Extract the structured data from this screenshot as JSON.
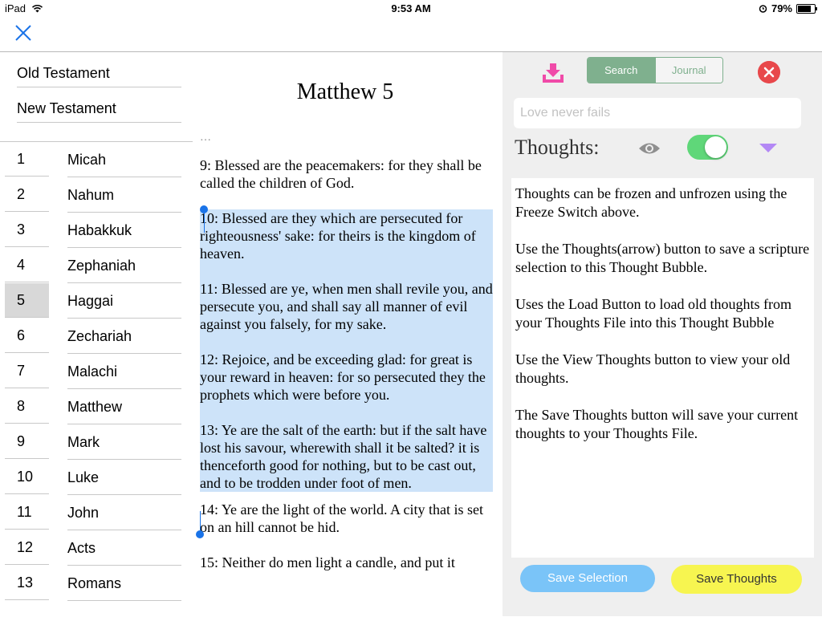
{
  "status_bar": {
    "device": "iPad",
    "time": "9:53 AM",
    "battery": "79%",
    "battery_level": 0.79
  },
  "testaments": [
    {
      "label": "Old Testament"
    },
    {
      "label": "New Testament"
    }
  ],
  "books": [
    {
      "num": "1",
      "name": "Micah"
    },
    {
      "num": "2",
      "name": "Nahum"
    },
    {
      "num": "3",
      "name": "Habakkuk"
    },
    {
      "num": "4",
      "name": "Zephaniah"
    },
    {
      "num": "5",
      "name": "Haggai",
      "selected": true
    },
    {
      "num": "6",
      "name": "Zechariah"
    },
    {
      "num": "7",
      "name": "Malachi"
    },
    {
      "num": "8",
      "name": "Matthew"
    },
    {
      "num": "9",
      "name": "Mark"
    },
    {
      "num": "10",
      "name": "Luke"
    },
    {
      "num": "11",
      "name": "John"
    },
    {
      "num": "12",
      "name": "Acts"
    },
    {
      "num": "13",
      "name": "Romans"
    }
  ],
  "scripture": {
    "title": "Matthew 5",
    "cut_text": "…",
    "verses": [
      {
        "text": " 9: Blessed are the peacemakers: for they shall be called the children of God.",
        "selected": false
      },
      {
        "text": " 10: Blessed are they which are persecuted for righteousness' sake: for theirs is the kingdom of heaven.",
        "selected": true
      },
      {
        "text": " 11: Blessed are ye, when men shall revile you, and persecute you, and shall say all manner of evil against you falsely, for my sake.",
        "selected": true
      },
      {
        "text": " 12: Rejoice, and be exceeding glad: for great is your reward in heaven: for so persecuted they the prophets which were before you.",
        "selected": true
      },
      {
        "text": " 13: Ye are the salt of the earth: but if the salt have lost his savour, wherewith shall it be salted? it is thenceforth good for nothing, but to be cast out, and to be trodden under foot of men.",
        "selected": true
      },
      {
        "text": "14: Ye are the light of the world. A city that is set on an hill cannot be hid.",
        "selected": false
      },
      {
        "text": " 15: Neither do men light a candle, and put it",
        "selected": false
      }
    ]
  },
  "panel": {
    "tab_search": "Search",
    "tab_journal": "Journal",
    "search_placeholder": "Love never fails",
    "thoughts_label": "Thoughts:",
    "freeze_on": true,
    "thoughts_paragraphs": [
      "Thoughts can be frozen and unfrozen using the Freeze Switch above.",
      "Use the Thoughts(arrow) button to save a scripture selection to this Thought Bubble.",
      "Uses the Load Button to load old thoughts from your Thoughts File into this Thought Bubble",
      "Use the View Thoughts button to view your old thoughts.",
      "The Save Thoughts button will save your current thoughts to your Thoughts File."
    ],
    "save_selection_label": "Save Selection",
    "save_thoughts_label": "Save Thoughts"
  },
  "colors": {
    "selection": "#cde3f9",
    "toggle_on": "#5fd779",
    "segment": "#7fb08e",
    "close_red": "#e8484b",
    "download_pink": "#f04aa8",
    "triangle_purple": "#b388f5",
    "save_selection_blue": "#7ac4f8",
    "save_thoughts_yellow": "#f7f550"
  },
  "icons": [
    "wifi-icon",
    "alarm-icon",
    "battery-icon",
    "close-icon",
    "download-icon",
    "close-circle-icon",
    "eye-icon",
    "triangle-down-icon"
  ]
}
